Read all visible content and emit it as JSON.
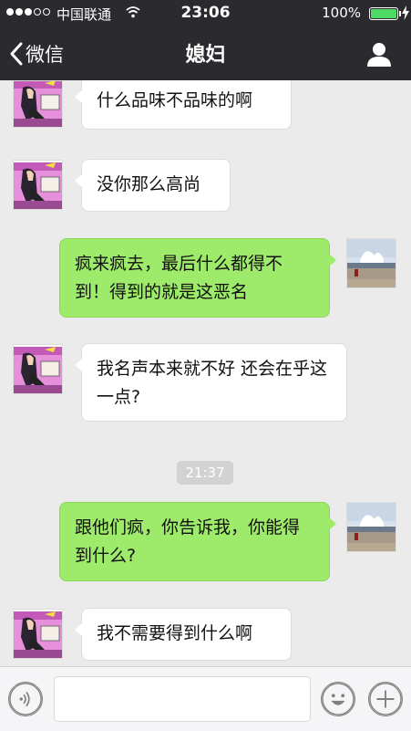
{
  "status_bar": {
    "carrier": "中国联通",
    "time": "23:06",
    "battery_percent": "100%",
    "signal_bars_filled": 3,
    "signal_bars_total": 5
  },
  "nav": {
    "back_label": "微信",
    "title": "媳妇",
    "profile_icon": "person-icon"
  },
  "messages": [
    {
      "side": "in",
      "text": "什么品味不品味的啊"
    },
    {
      "side": "in",
      "text": "没你那么高尚"
    },
    {
      "side": "out",
      "text": "疯来疯去，最后什么都得不到！得到的就是这恶名"
    },
    {
      "side": "in",
      "text": "我名声本来就不好  还会在乎这一点?"
    },
    {
      "side": "out",
      "text": "跟他们疯，你告诉我，你能得到什么?"
    },
    {
      "side": "in",
      "text": "我不需要得到什么啊"
    }
  ],
  "timestamp": "21:37",
  "input": {
    "value": "",
    "placeholder": "",
    "voice_icon": "voice-icon",
    "emoji_icon": "emoji-icon",
    "plus_icon": "plus-icon"
  },
  "colors": {
    "nav_bg": "#2b2b2f",
    "outgoing_bubble": "#9eea6a",
    "incoming_bubble": "#ffffff",
    "chat_bg": "#ebebeb",
    "battery_fill": "#4cd964"
  }
}
